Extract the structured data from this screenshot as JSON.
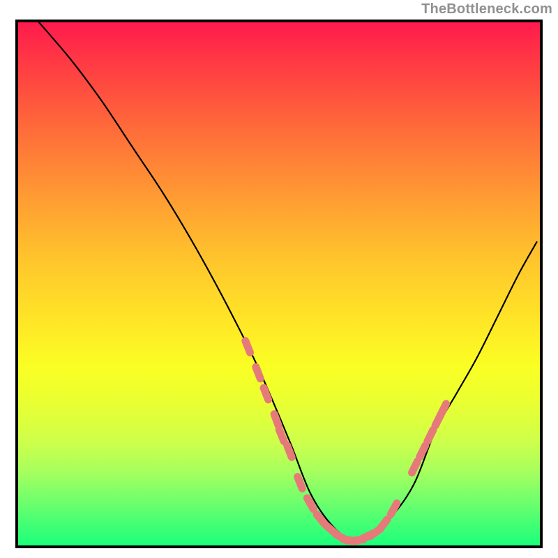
{
  "watermark": "TheBottleneck.com",
  "chart_data": {
    "type": "line",
    "title": "",
    "xlabel": "",
    "ylabel": "",
    "xlim": [
      0,
      100
    ],
    "ylim": [
      0,
      100
    ],
    "series": [
      {
        "name": "curve",
        "x": [
          4,
          10,
          16,
          22,
          28,
          34,
          40,
          46,
          52,
          56,
          60,
          64,
          68,
          72,
          76,
          80,
          84,
          88,
          92,
          96,
          99.4
        ],
        "values": [
          100,
          93,
          85,
          76,
          67,
          57,
          46,
          34,
          20,
          10,
          4,
          1,
          2,
          6,
          12,
          22,
          29,
          36,
          44,
          52,
          58
        ]
      }
    ],
    "markers": {
      "name": "scatter-near-minimum",
      "color": "#e67a7a",
      "x": [
        44,
        46,
        47.5,
        49.5,
        50.5,
        52,
        54,
        56,
        58,
        60,
        62,
        63.5,
        65,
        66,
        67,
        68.5,
        70,
        72,
        76,
        77.5,
        79,
        80.5,
        81.5
      ],
      "y": [
        38,
        33,
        29,
        24,
        21,
        18,
        12,
        8,
        5,
        3,
        1.5,
        1,
        1,
        1.3,
        1.8,
        2.5,
        4,
        7,
        15,
        18,
        21,
        24,
        26
      ]
    },
    "gradient_stops": [
      {
        "pos": 0.0,
        "color": "#ff1a4d"
      },
      {
        "pos": 0.08,
        "color": "#ff3b43"
      },
      {
        "pos": 0.2,
        "color": "#ff6a3a"
      },
      {
        "pos": 0.33,
        "color": "#ff9a33"
      },
      {
        "pos": 0.46,
        "color": "#ffc72c"
      },
      {
        "pos": 0.58,
        "color": "#ffe826"
      },
      {
        "pos": 0.66,
        "color": "#faff24"
      },
      {
        "pos": 0.73,
        "color": "#e8ff33"
      },
      {
        "pos": 0.8,
        "color": "#cfff4a"
      },
      {
        "pos": 0.86,
        "color": "#a6ff5e"
      },
      {
        "pos": 0.92,
        "color": "#6bff6e"
      },
      {
        "pos": 1.0,
        "color": "#1bff7a"
      }
    ]
  }
}
